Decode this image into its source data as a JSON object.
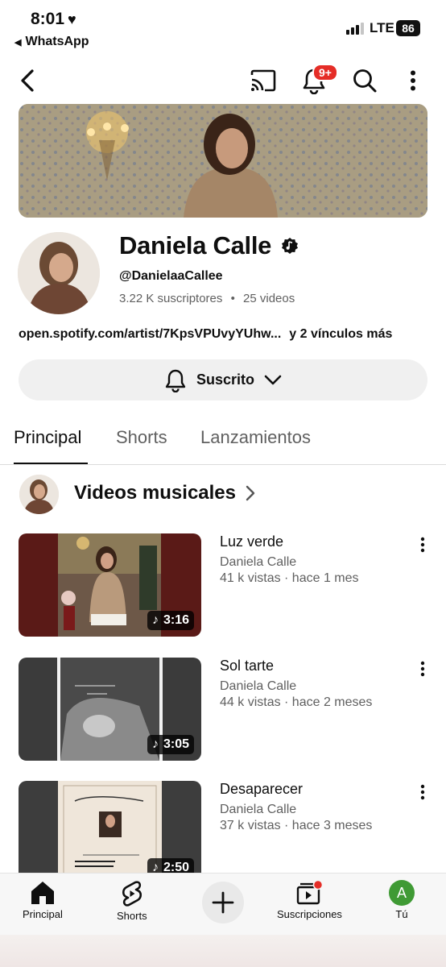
{
  "status_bar": {
    "time": "8:01",
    "back_app": "WhatsApp",
    "network": "LTE",
    "battery": "86"
  },
  "topbar": {
    "notification_badge": "9+"
  },
  "channel": {
    "name": "Daniela Calle",
    "handle": "@DanielaaCallee",
    "subscribers": "3.22 K suscriptores",
    "separator": "•",
    "videos_count": "25 videos",
    "link": "open.spotify.com/artist/7KpsVPUvyYUhw...",
    "more_links": "y 2 vínculos más",
    "subscribe_label": "Suscrito"
  },
  "tabs": [
    {
      "label": "Principal"
    },
    {
      "label": "Shorts"
    },
    {
      "label": "Lanzamientos"
    }
  ],
  "section": {
    "title": "Videos musicales"
  },
  "videos": [
    {
      "title": "Luz verde",
      "channel": "Daniela Calle",
      "meta": "41 k vistas · hace 1 mes",
      "duration": "3:16"
    },
    {
      "title": "Sol tarte",
      "channel": "Daniela Calle",
      "meta": "44 k vistas · hace 2 meses",
      "duration": "3:05"
    },
    {
      "title": "Desaparecer",
      "channel": "Daniela Calle",
      "meta": "37 k vistas · hace 3 meses",
      "duration": "2:50"
    }
  ],
  "bottom_nav": {
    "home": "Principal",
    "shorts": "Shorts",
    "subscriptions": "Suscripciones",
    "you": "Tú",
    "you_initial": "A"
  },
  "colors": {
    "accent_red": "#e52d27",
    "avatar_green": "#3f9a34"
  }
}
